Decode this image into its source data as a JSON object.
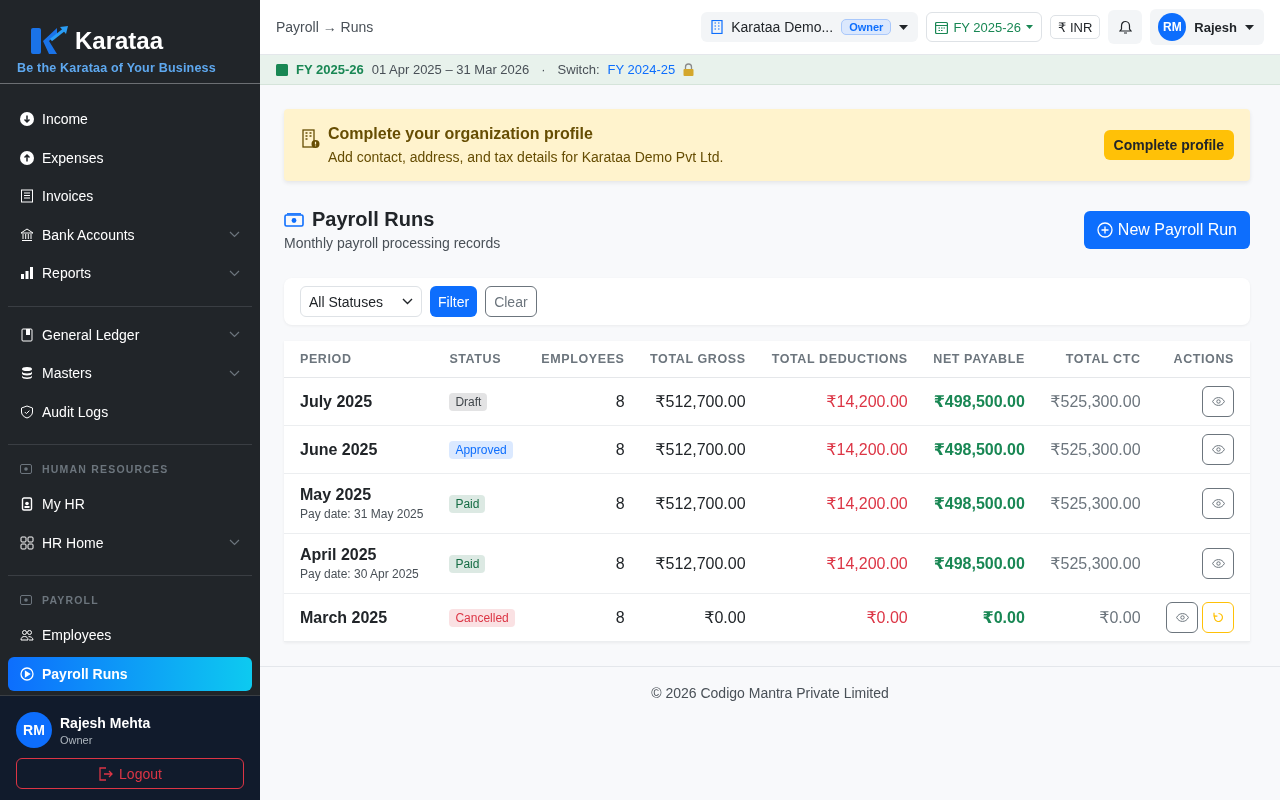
{
  "brand": {
    "name": "Karataa",
    "tagline": "Be the Karataa of Your Business"
  },
  "sidebar": {
    "items": [
      {
        "kind": "item",
        "label": "Income",
        "has_submenu": false,
        "selected": false
      },
      {
        "kind": "item",
        "label": "Expenses",
        "has_submenu": false,
        "selected": false
      },
      {
        "kind": "item",
        "label": "Invoices",
        "has_submenu": false,
        "selected": false
      },
      {
        "kind": "item",
        "label": "Bank Accounts",
        "has_submenu": true,
        "selected": false
      },
      {
        "kind": "item",
        "label": "Reports",
        "has_submenu": true,
        "selected": false
      },
      {
        "kind": "divider"
      },
      {
        "kind": "item",
        "label": "General Ledger",
        "has_submenu": true,
        "selected": false
      },
      {
        "kind": "item",
        "label": "Masters",
        "has_submenu": true,
        "selected": false
      },
      {
        "kind": "item",
        "label": "Audit Logs",
        "has_submenu": false,
        "selected": false
      },
      {
        "kind": "divider"
      },
      {
        "kind": "section",
        "label": "HUMAN RESOURCES"
      },
      {
        "kind": "item",
        "label": "My HR",
        "has_submenu": false,
        "selected": false
      },
      {
        "kind": "item",
        "label": "HR Home",
        "has_submenu": true,
        "selected": false
      },
      {
        "kind": "divider"
      },
      {
        "kind": "section",
        "label": "PAYROLL"
      },
      {
        "kind": "item",
        "label": "Employees",
        "has_submenu": false,
        "selected": false
      },
      {
        "kind": "item",
        "label": "Payroll Runs",
        "has_submenu": false,
        "selected": true
      }
    ]
  },
  "user": {
    "initials": "RM",
    "name": "Rajesh Mehta",
    "role": "Owner",
    "logout": "Logout"
  },
  "header": {
    "breadcrumb": "Payroll → Runs",
    "org": "Karataa Demo...",
    "org_role": "Owner",
    "fy": "FY 2025-26",
    "currency": "₹ INR",
    "user_initials": "RM",
    "user_name": "Rajesh"
  },
  "fy_bar": {
    "fy": "FY 2025-26",
    "range": "01 Apr 2025 – 31 Mar 2026",
    "separator": "·",
    "switch_label": "Switch:",
    "switch_fy": "FY 2024-25"
  },
  "alert": {
    "title": "Complete your organization profile",
    "text": "Add contact, address, and tax details for Karataa Demo Pvt Ltd.",
    "button": "Complete profile"
  },
  "page": {
    "title": "Payroll Runs",
    "subtitle": "Monthly payroll processing records",
    "new_button": "New Payroll Run"
  },
  "filters": {
    "status": "All Statuses",
    "filter": "Filter",
    "clear": "Clear"
  },
  "table": {
    "columns": [
      "PERIOD",
      "STATUS",
      "EMPLOYEES",
      "TOTAL GROSS",
      "TOTAL DEDUCTIONS",
      "NET PAYABLE",
      "TOTAL CTC",
      "ACTIONS"
    ],
    "rows": [
      {
        "period": "July 2025",
        "status": "Draft",
        "color": "#41464b",
        "employees": "8",
        "gross": "₹512,700.00",
        "deductions": "₹14,200.00",
        "net": "₹498,500.00",
        "ctc": "₹525,300.00",
        "actions": [
          {
            "kind": "view"
          }
        ]
      },
      {
        "period": "June 2025",
        "status": "Approved",
        "color": "#0d6efd",
        "employees": "8",
        "gross": "₹512,700.00",
        "deductions": "₹14,200.00",
        "net": "₹498,500.00",
        "ctc": "₹525,300.00",
        "actions": [
          {
            "kind": "view"
          }
        ]
      },
      {
        "period": "May 2025",
        "pay_date": "Pay date: 31 May 2025",
        "status": "Paid",
        "color": "#146c43",
        "employees": "8",
        "gross": "₹512,700.00",
        "deductions": "₹14,200.00",
        "net": "₹498,500.00",
        "ctc": "₹525,300.00",
        "actions": [
          {
            "kind": "view"
          }
        ]
      },
      {
        "period": "April 2025",
        "pay_date": "Pay date: 30 Apr 2025",
        "status": "Paid",
        "color": "#146c43",
        "employees": "8",
        "gross": "₹512,700.00",
        "deductions": "₹14,200.00",
        "net": "₹498,500.00",
        "ctc": "₹525,300.00",
        "actions": [
          {
            "kind": "view"
          }
        ]
      },
      {
        "period": "March 2025",
        "status": "Cancelled",
        "color": "#dc3545",
        "employees": "8",
        "gross": "₹0.00",
        "deductions": "₹0.00",
        "net": "₹0.00",
        "ctc": "₹0.00",
        "actions": [
          {
            "kind": "view"
          },
          {
            "kind": "restore"
          }
        ]
      }
    ]
  },
  "footer": "© 2026 Codigo Mantra Private Limited"
}
